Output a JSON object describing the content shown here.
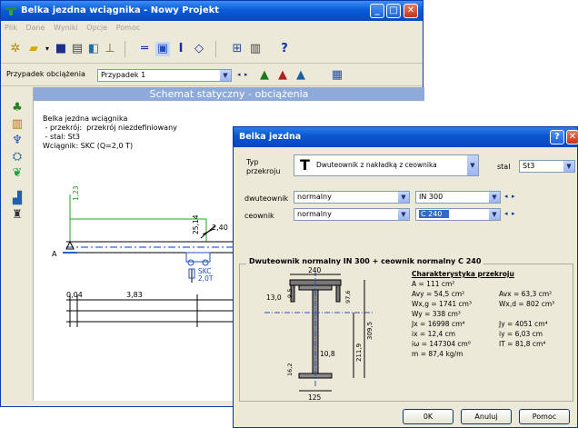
{
  "main_window": {
    "title": "Belka jezdna wciągnika - Nowy Projekt",
    "menu": [
      "Plik",
      "Dane",
      "Wyniki",
      "Opcje",
      "Pomoc"
    ],
    "load_case_label": "Przypadek obciążenia",
    "load_case_value": "Przypadek 1",
    "canvas_title": "Schemat statyczny - obciążenia",
    "info_lines": [
      "Belka jezdna wciągnika",
      " - przekrój:  przekrój niezdefiniowany",
      " - stal: St3",
      "Wciągnik: SKC (Q=2,0 T)"
    ],
    "diagram": {
      "v1": "1,23",
      "v2": "25,14",
      "v3": "2,40",
      "support": "A",
      "hoist": "SKC",
      "hoist_load": "2,0T",
      "dim1": "0,04",
      "dim2": "3,83"
    }
  },
  "dialog": {
    "title": "Belka jezdna",
    "type_label": "Typ\nprzekroju",
    "type_value": "Dwuteownik z nakładką z ceownika",
    "steel_label": "stal",
    "steel_value": "St3",
    "row1_label": "dwuteownik",
    "row1_kind": "normalny",
    "row1_size": "IN 300",
    "row2_label": "ceownik",
    "row2_kind": "normalny",
    "row2_size": "C 240",
    "section_heading": "Dwuteownik normalny IN 300 + ceownik normalny C 240",
    "props_heading": "Charakterystyka przekroju",
    "props_left": [
      "A = 111 cm²",
      "Avy = 54,5 cm²",
      "Wx,g = 1741 cm³",
      "Wy = 338 cm³",
      "Jx = 16998 cm⁴",
      "ix = 12,4 cm",
      "iω = 147304 cm⁶",
      "m = 87,4 kg/m"
    ],
    "props_right": [
      "",
      "Avx = 63,3 cm²",
      "Wx,d = 802 cm³",
      "",
      "Jy = 4051 cm⁴",
      "iy = 6,03 cm",
      "IT = 81,8 cm⁴",
      ""
    ],
    "dims": {
      "top_width": "240",
      "flange_t": "13,0",
      "flange_t2": "9,5",
      "h1": "97,6",
      "h_total": "309,5",
      "h2": "211,9",
      "web": "10,8",
      "bottom_t": "16,2",
      "bottom_width": "125"
    },
    "buttons": {
      "ok": "0K",
      "cancel": "Anuluj",
      "help": "Pomoc"
    }
  }
}
